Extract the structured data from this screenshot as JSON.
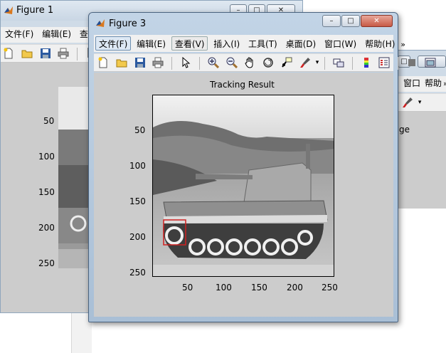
{
  "figure1": {
    "title": "Figure 1",
    "menu": [
      "文件(F)",
      "编辑(E)",
      "查看"
    ],
    "yticks": [
      "50",
      "100",
      "150",
      "200",
      "250"
    ]
  },
  "figure3": {
    "title": "Figure 3",
    "menu": [
      "文件(F)",
      "编辑(E)",
      "查看(V)",
      "插入(I)",
      "工具(T)",
      "桌面(D)",
      "窗口(W)",
      "帮助(H)"
    ],
    "overflow_glyph": "»",
    "plot_title": "Tracking Result",
    "yticks": [
      "50",
      "100",
      "150",
      "200",
      "250"
    ],
    "xticks": [
      "50",
      "100",
      "150",
      "200",
      "250"
    ],
    "tracking_box_color": "#d02020"
  },
  "figure2_partial": {
    "menu_fragments": [
      "窗口",
      "帮助"
    ],
    "overflow_glyph": "»",
    "text_fragment": "ge"
  },
  "icons": [
    "new-file-icon",
    "open-folder-icon",
    "save-icon",
    "print-icon",
    "pointer-icon",
    "zoom-in-icon",
    "zoom-out-icon",
    "pan-hand-icon",
    "rotate-icon",
    "data-cursor-icon",
    "brush-icon",
    "link-icon",
    "colorbar-icon",
    "legend-icon",
    "hide-tools-icon",
    "dock-icon"
  ],
  "colors": {
    "figure_bg": "#cccccc",
    "menubar_bg": "#f0f0f0",
    "window_frame": "#b7c8da"
  }
}
